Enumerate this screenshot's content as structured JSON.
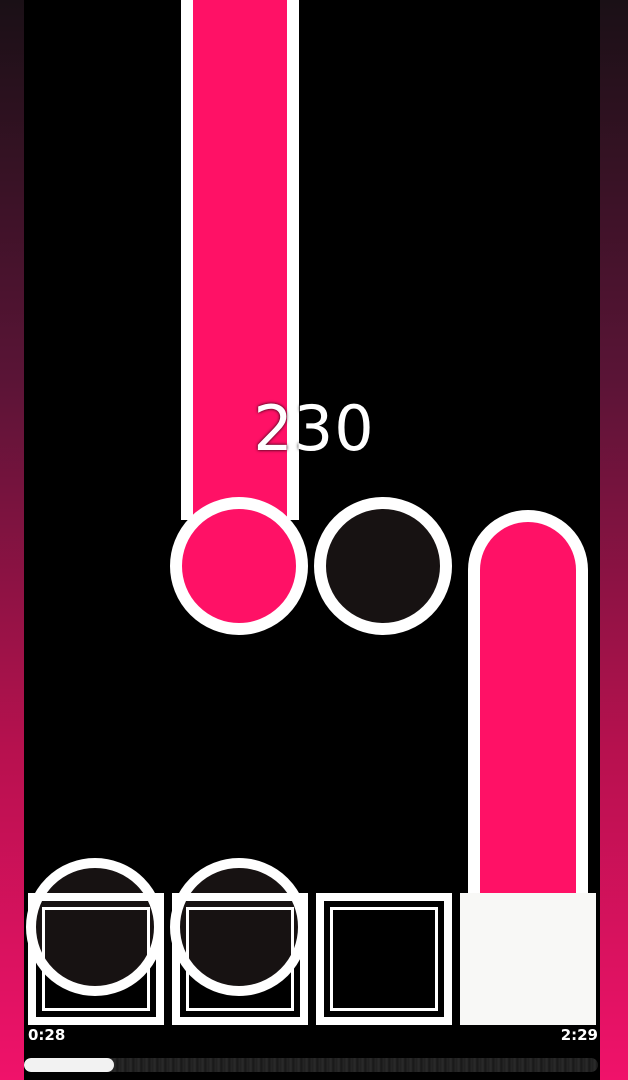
{
  "score": "230",
  "time": {
    "elapsed": "0:28",
    "total": "2:29"
  },
  "progress": {
    "fraction": 0.157
  },
  "colors": {
    "note_pink": "#ff1166",
    "note_dark": "#171212",
    "outline": "#ffffff",
    "background": "#000000"
  },
  "lanes": [
    {
      "name": "lane-1",
      "state": "idle"
    },
    {
      "name": "lane-2",
      "state": "idle"
    },
    {
      "name": "lane-3",
      "state": "idle"
    },
    {
      "name": "lane-4",
      "state": "pressed"
    }
  ]
}
